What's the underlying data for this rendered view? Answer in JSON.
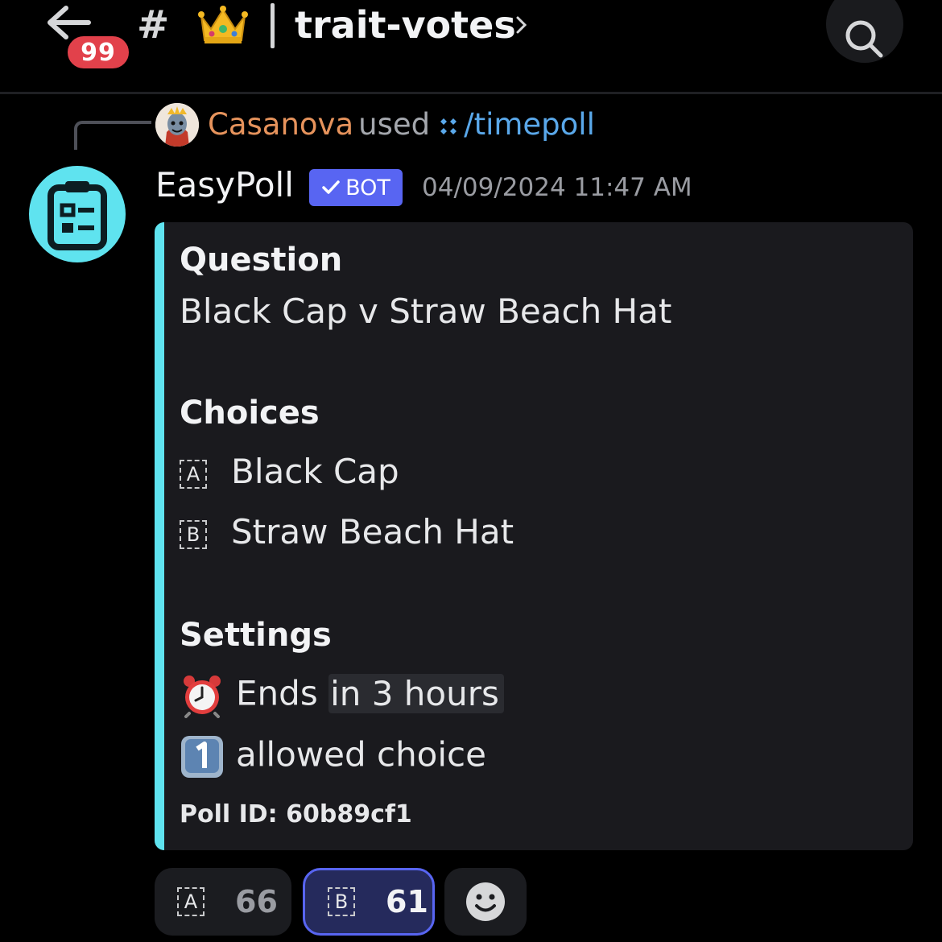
{
  "header": {
    "back_icon": "arrow-left-icon",
    "unread_badge": "99",
    "channel_prefix_icon": "hash-icon",
    "channel_emoji": "crown-icon",
    "channel_name": "trait-votes",
    "search_icon": "search-icon"
  },
  "reply": {
    "username": "Casanova",
    "used_text": "used",
    "command": "/timepoll",
    "command_icon": "app-command-icon",
    "username_color": "#e6935c",
    "command_color": "#5aa8ea"
  },
  "message": {
    "author": "EasyPoll",
    "bot_tag": "BOT",
    "timestamp": "04/09/2024 11:47 AM",
    "avatar_icon": "clipboard-icon",
    "accent_color": "#5fe3ef"
  },
  "embed": {
    "question_title": "Question",
    "question": "Black Cap v Straw Beach Hat",
    "choices_title": "Choices",
    "choices": [
      {
        "letter": "A",
        "label": "Black Cap"
      },
      {
        "letter": "B",
        "label": "Straw Beach Hat"
      }
    ],
    "settings_title": "Settings",
    "ends_prefix": "Ends",
    "ends_value": "in 3 hours",
    "ends_icon": "alarm-clock-icon",
    "allowed_icon": "keycap-one-icon",
    "allowed_text": "allowed choice",
    "poll_id": "Poll ID: 60b89cf1"
  },
  "reactions": [
    {
      "letter": "A",
      "count": "66",
      "selected": false
    },
    {
      "letter": "B",
      "count": "61",
      "selected": true
    }
  ],
  "add_reaction_icon": "smiley-face-icon"
}
